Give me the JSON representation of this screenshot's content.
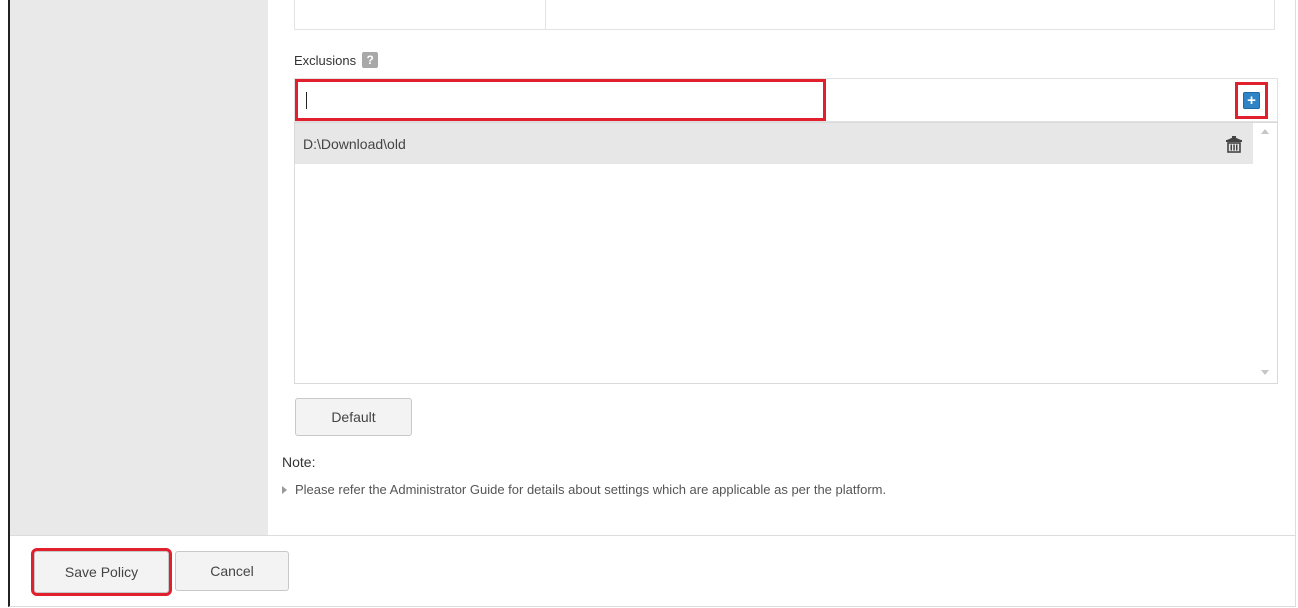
{
  "exclusions": {
    "label": "Exclusions",
    "help_glyph": "?",
    "input_value": "",
    "add_glyph": "+",
    "items": [
      {
        "path": "D:\\Download\\old"
      }
    ]
  },
  "buttons": {
    "default_label": "Default",
    "save_label": "Save Policy",
    "cancel_label": "Cancel"
  },
  "note": {
    "title": "Note:",
    "text": "Please refer the Administrator Guide for details about settings which are applicable as per the platform."
  },
  "icons": {
    "help": "help-icon",
    "add": "add-icon",
    "delete": "trash-icon",
    "scroll_up": "chevron-up-icon",
    "scroll_down": "chevron-down-icon",
    "note_bullet": "triangle-right-icon"
  },
  "colors": {
    "highlight": "#e0202c",
    "add_button": "#2f84c6",
    "sidebar": "#e9e9e9",
    "selected_row": "#e7e7e7"
  }
}
